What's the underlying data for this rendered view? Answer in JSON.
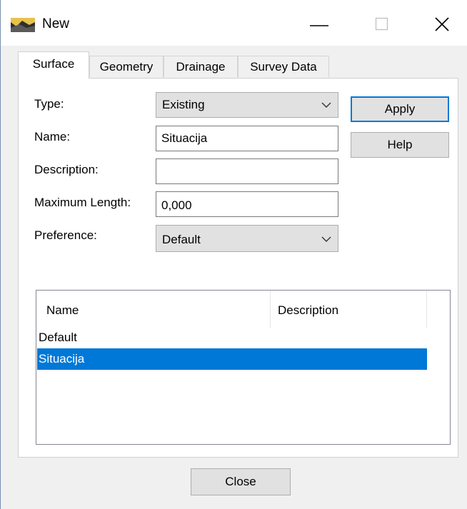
{
  "window": {
    "title": "New",
    "icon": "landscape-app-icon"
  },
  "tabs": [
    {
      "label": "Surface",
      "active": true
    },
    {
      "label": "Geometry",
      "active": false
    },
    {
      "label": "Drainage",
      "active": false
    },
    {
      "label": "Survey Data",
      "active": false
    }
  ],
  "form": {
    "type_label": "Type:",
    "type_value": "Existing",
    "name_label": "Name:",
    "name_value": "Situacija",
    "description_label": "Description:",
    "description_value": "",
    "max_length_label": "Maximum Length:",
    "max_length_value": "0,000",
    "preference_label": "Preference:",
    "preference_value": "Default"
  },
  "buttons": {
    "apply": "Apply",
    "help": "Help",
    "close": "Close"
  },
  "list": {
    "columns": [
      "Name",
      "Description"
    ],
    "rows": [
      {
        "name": "Default",
        "description": "",
        "selected": false
      },
      {
        "name": "Situacija",
        "description": "",
        "selected": true
      }
    ]
  },
  "colors": {
    "selection": "#0078d7",
    "focus_border": "#0078d7"
  }
}
